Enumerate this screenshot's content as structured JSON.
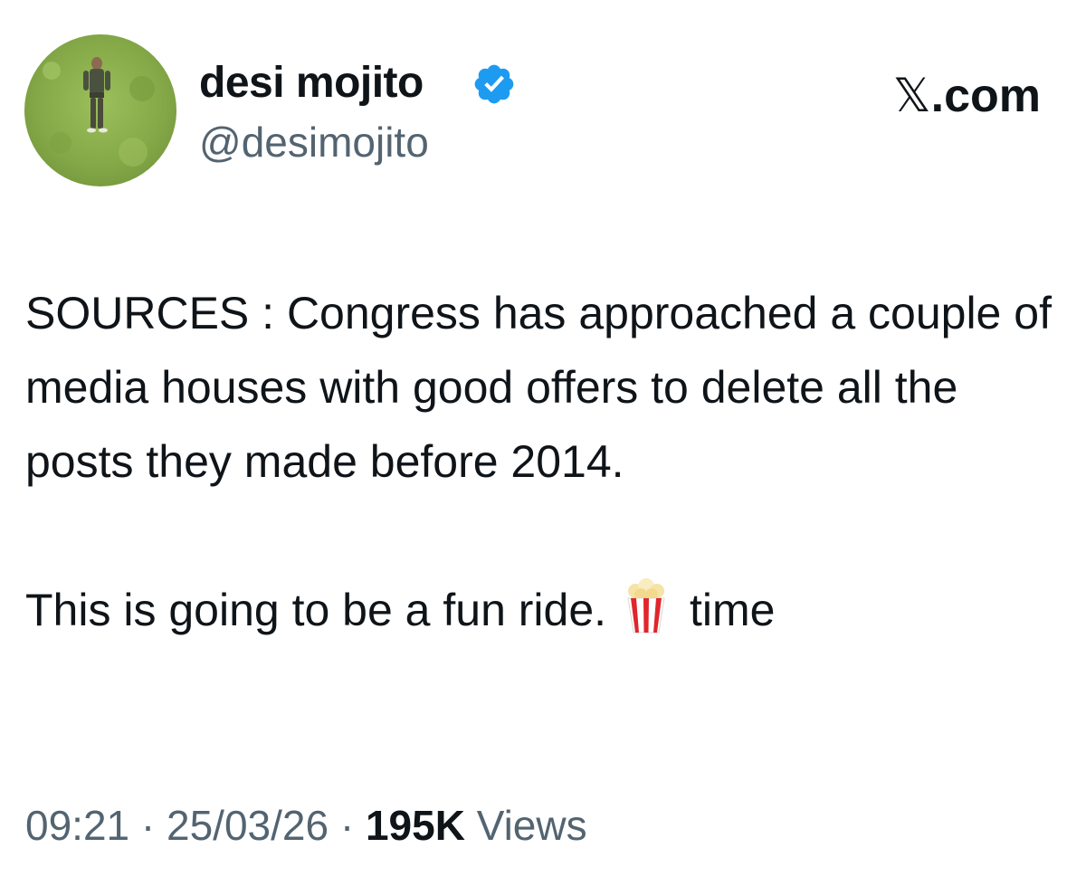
{
  "author": {
    "display_name": "desi mojito",
    "handle": "@desimojito",
    "verified": true,
    "verified_color": "#1d9bf0",
    "avatar_icon": "profile-photo"
  },
  "source": {
    "logo_mark": "𝕏",
    "logo_suffix": ".com"
  },
  "tweet": {
    "lines": [
      "SOURCES : Congress has approached a couple of media houses with good offers to delete all the posts they made before 2014.",
      "This is going to be a fun ride."
    ],
    "emoji_icon": "popcorn-icon",
    "trailing_word": "time"
  },
  "meta": {
    "time": "09:21",
    "separator": " · ",
    "date": "25/03/26",
    "views_count": "195K",
    "views_label": " Views"
  },
  "colors": {
    "text": "#0f1419",
    "secondary_text": "#536471",
    "background": "#ffffff"
  }
}
